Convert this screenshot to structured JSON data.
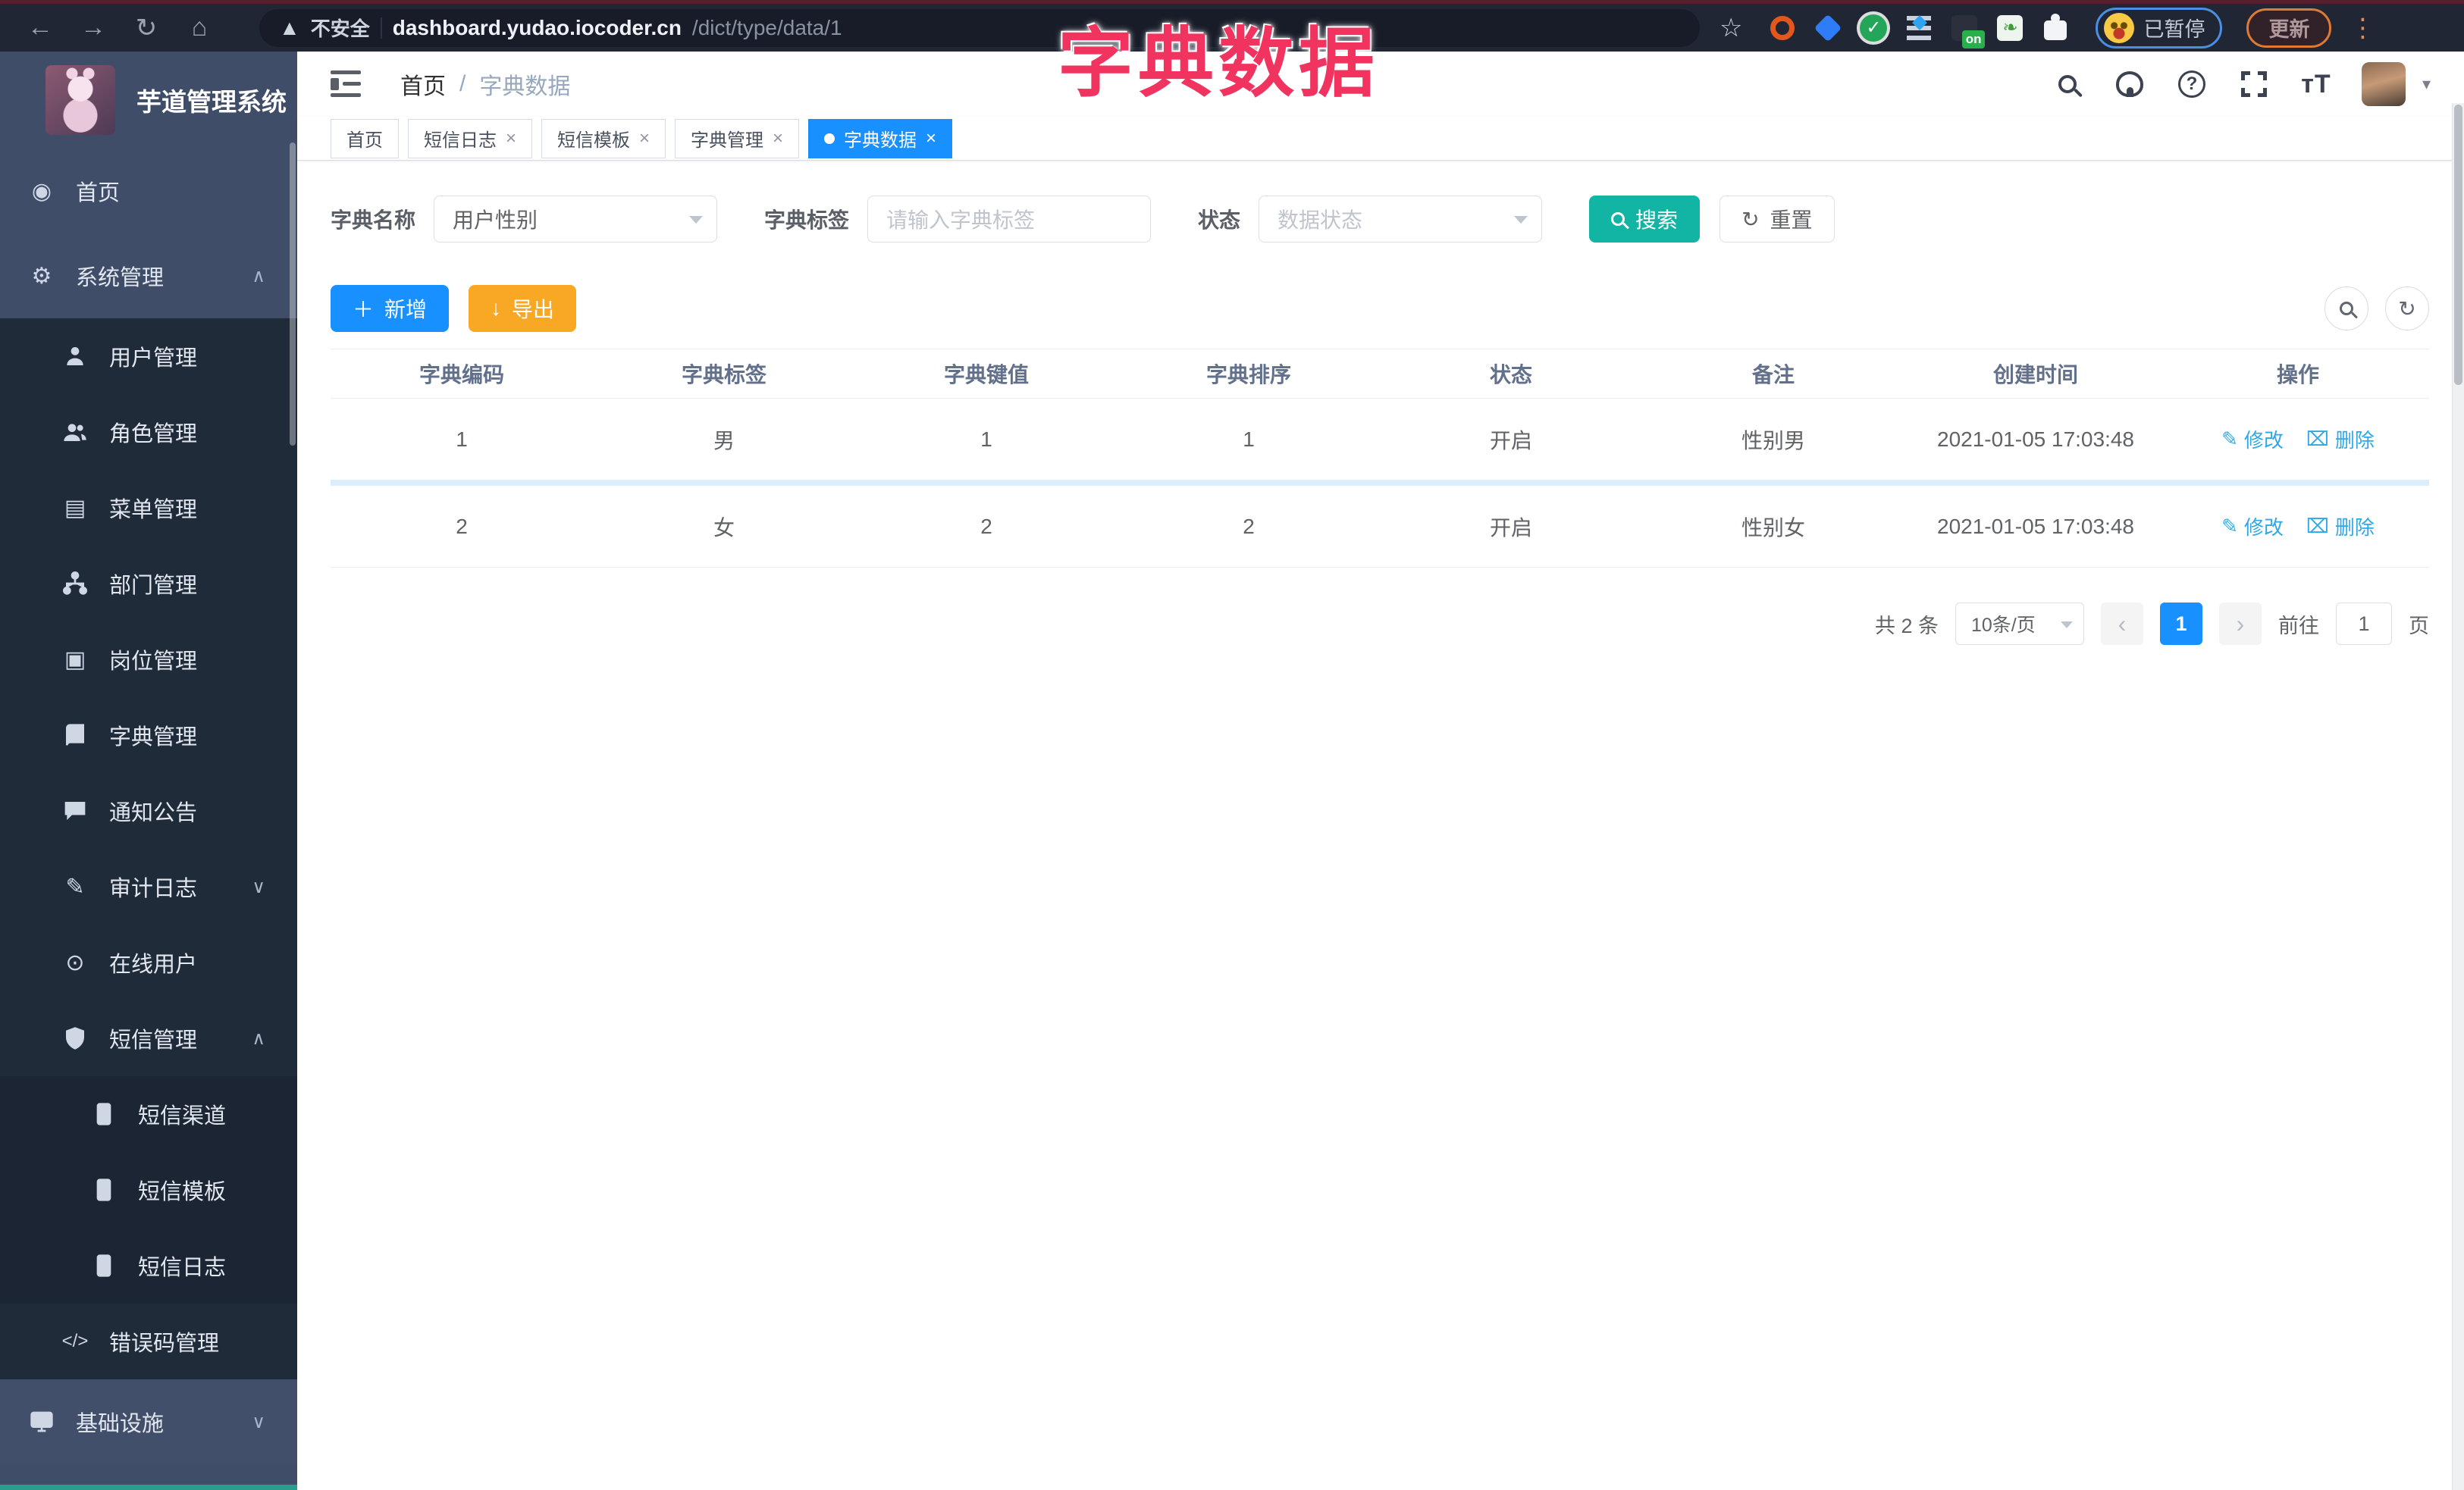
{
  "browser": {
    "security_label": "不安全",
    "url_domain": "dashboard.yudao.iocoder.cn",
    "url_path": "/dict/type/data/1",
    "extension_badge": "on",
    "paused_label": "已暂停",
    "update_label": "更新"
  },
  "overlay_title": "字典数据",
  "sidebar": {
    "logo_title": "芋道管理系统",
    "items": [
      {
        "label": "首页",
        "icon": "dashboard-icon"
      },
      {
        "label": "系统管理",
        "icon": "gear-icon",
        "chevron": "up"
      },
      {
        "label": "用户管理",
        "icon": "user-icon"
      },
      {
        "label": "角色管理",
        "icon": "roles-icon"
      },
      {
        "label": "菜单管理",
        "icon": "menu-list-icon"
      },
      {
        "label": "部门管理",
        "icon": "org-tree-icon"
      },
      {
        "label": "岗位管理",
        "icon": "badge-icon"
      },
      {
        "label": "字典管理",
        "icon": "book-icon"
      },
      {
        "label": "通知公告",
        "icon": "announcement-icon"
      },
      {
        "label": "审计日志",
        "icon": "edit-doc-icon",
        "chevron": "down"
      },
      {
        "label": "在线用户",
        "icon": "online-icon"
      },
      {
        "label": "短信管理",
        "icon": "shield-check-icon",
        "chevron": "up"
      },
      {
        "label": "短信渠道",
        "icon": "phone-icon"
      },
      {
        "label": "短信模板",
        "icon": "phone-icon"
      },
      {
        "label": "短信日志",
        "icon": "phone-icon"
      },
      {
        "label": "错误码管理",
        "icon": "code-icon"
      },
      {
        "label": "基础设施",
        "icon": "monitor-icon",
        "chevron": "down"
      }
    ]
  },
  "navbar": {
    "breadcrumb_home": "首页",
    "breadcrumb_sep": "/",
    "breadcrumb_current": "字典数据"
  },
  "tabs": [
    {
      "label": "首页"
    },
    {
      "label": "短信日志"
    },
    {
      "label": "短信模板"
    },
    {
      "label": "字典管理"
    },
    {
      "label": "字典数据"
    }
  ],
  "filters": {
    "dict_name_label": "字典名称",
    "dict_name_value": "用户性别",
    "dict_tag_label": "字典标签",
    "dict_tag_placeholder": "请输入字典标签",
    "status_label": "状态",
    "status_placeholder": "数据状态",
    "search_label": "搜索",
    "reset_label": "重置"
  },
  "toolbar": {
    "add_label": "新增",
    "export_label": "导出"
  },
  "table": {
    "headers": [
      "字典编码",
      "字典标签",
      "字典键值",
      "字典排序",
      "状态",
      "备注",
      "创建时间",
      "操作"
    ],
    "rows": [
      {
        "cells": [
          "1",
          "男",
          "1",
          "1",
          "开启",
          "性别男",
          "2021-01-05 17:03:48"
        ]
      },
      {
        "cells": [
          "2",
          "女",
          "2",
          "2",
          "开启",
          "性别女",
          "2021-01-05 17:03:48"
        ]
      }
    ],
    "actions": {
      "edit": "修改",
      "delete": "删除"
    }
  },
  "pagination": {
    "total": "共 2 条",
    "page_size": "10条/页",
    "current_page": "1",
    "goto_label": "前往",
    "goto_value": "1",
    "page_unit": "页"
  },
  "theme": {
    "sidebar_bg": "#3f4d68",
    "submenu_bg": "#202b3a",
    "active_tab_bg": "#1890ff",
    "search_btn_bg": "#12b5a3",
    "add_btn_bg": "#1890ff",
    "export_btn_bg": "#f9a825",
    "overlay_color": "#f0345f",
    "link_color": "#2ea8e6"
  }
}
